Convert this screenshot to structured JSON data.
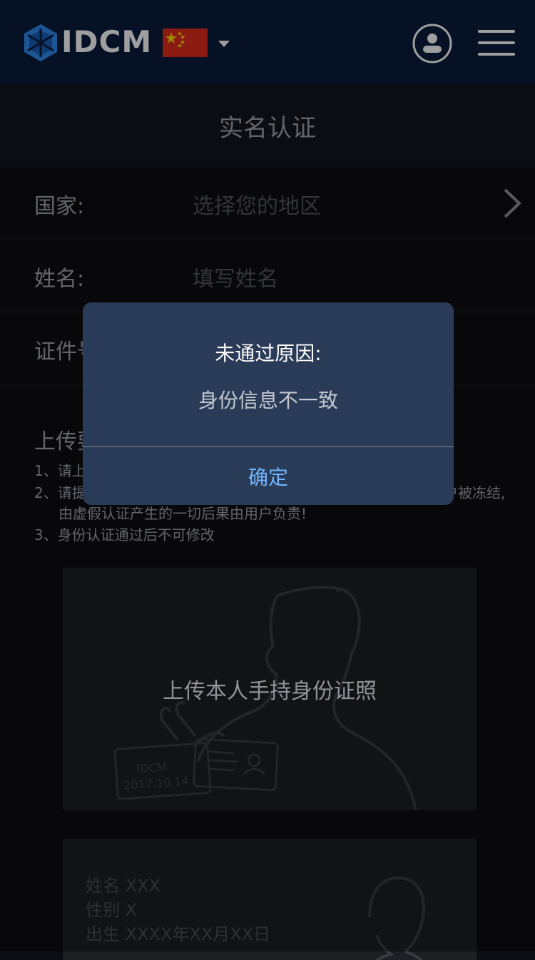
{
  "header": {
    "logo_text": "IDCM",
    "flag_icon": "china-flag-icon",
    "colors": {
      "header_bg": "#0b1c3d",
      "logo_blue": "#2f8bf0"
    }
  },
  "page": {
    "title": "实名认证"
  },
  "form": {
    "rows": [
      {
        "label": "国家:",
        "value": "选择您的地区"
      },
      {
        "label": "姓名:",
        "value": "填写姓名"
      },
      {
        "label": "证件号",
        "value": ""
      }
    ]
  },
  "upload": {
    "title": "上传要",
    "requirements": [
      "1、请上",
      "2、请提",
      "户被冻结,",
      "由虚假认证产生的一切后果由用户负责!",
      "3、身份认证通过后不可修改"
    ]
  },
  "photo_card": {
    "label": "上传本人手持身份证照",
    "card_brand": "IDCM",
    "card_date": "2017.10.14"
  },
  "id_card_sample": {
    "lines": [
      "姓名  XXX",
      "性别  X",
      "出生  XXXX年XX月XX日"
    ]
  },
  "dialog": {
    "title": "未通过原因:",
    "message": "身份信息不一致",
    "confirm_label": "确定",
    "colors": {
      "bg": "#2a3b58",
      "button": "#71b5ff"
    }
  }
}
